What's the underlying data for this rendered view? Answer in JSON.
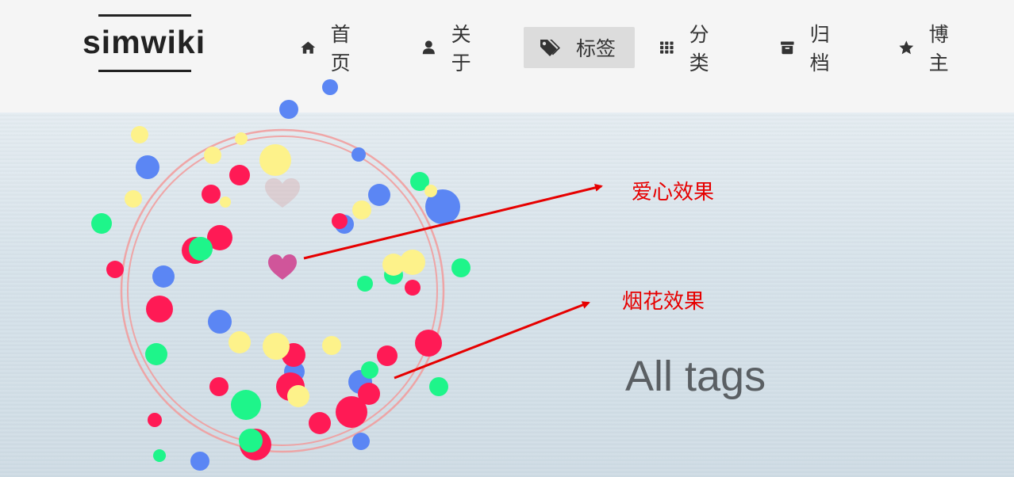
{
  "header": {
    "logo_text": "simwiki"
  },
  "nav": {
    "items": [
      {
        "label": "首页",
        "icon": "home-icon",
        "active": false
      },
      {
        "label": "关于",
        "icon": "user-icon",
        "active": false
      },
      {
        "label": "标签",
        "icon": "tags-icon",
        "active": true
      },
      {
        "label": "分类",
        "icon": "grid-icon",
        "active": false
      },
      {
        "label": "归档",
        "icon": "archive-icon",
        "active": false
      },
      {
        "label": "博主",
        "icon": "star-icon",
        "active": false
      }
    ]
  },
  "annotations": {
    "heart_effect": "爱心效果",
    "firework_effect": "烟花效果"
  },
  "main": {
    "title": "All tags"
  },
  "colors": {
    "annotation": "#e60000",
    "firework_red": "#ff1a55",
    "firework_blue": "#5b86f4",
    "firework_green": "#1ef58a",
    "firework_yellow": "#fdf28a",
    "heart": "#d0559a",
    "active_nav_bg": "#dcdcdc"
  }
}
